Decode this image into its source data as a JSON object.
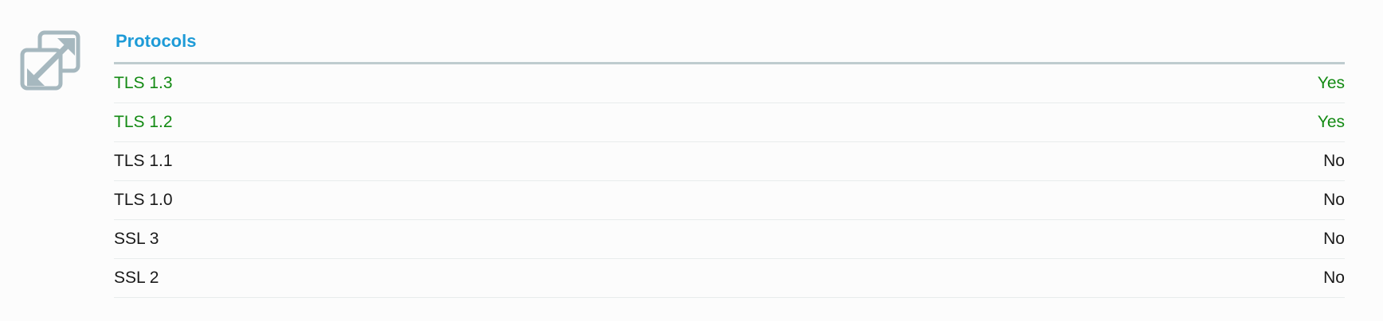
{
  "section": {
    "icon": "expand-arrows-icon",
    "title": "Protocols",
    "colors": {
      "title": "#1e9bd7",
      "supported": "#138a13",
      "unsupported": "#1a1a1a",
      "icon": "#a6b8bf"
    }
  },
  "protocols": [
    {
      "name": "TLS 1.3",
      "value": "Yes",
      "supported": true
    },
    {
      "name": "TLS 1.2",
      "value": "Yes",
      "supported": true
    },
    {
      "name": "TLS 1.1",
      "value": "No",
      "supported": false
    },
    {
      "name": "TLS 1.0",
      "value": "No",
      "supported": false
    },
    {
      "name": "SSL 3",
      "value": "No",
      "supported": false
    },
    {
      "name": "SSL 2",
      "value": "No",
      "supported": false
    }
  ]
}
